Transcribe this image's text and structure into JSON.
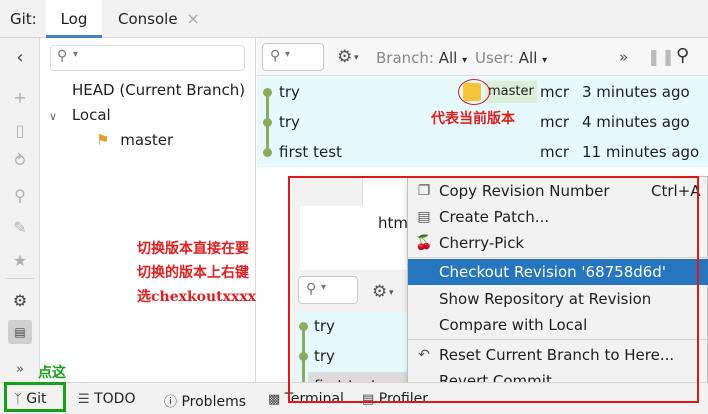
{
  "tabbar": {
    "prefix": "Git:",
    "tabs": [
      {
        "label": "Log",
        "active": true
      },
      {
        "label": "Console",
        "active": false
      }
    ],
    "close_symbol": "×"
  },
  "branches": {
    "head": "HEAD (Current Branch)",
    "local_group": "Local",
    "local_branches": [
      "master"
    ]
  },
  "log_toolbar": {
    "branch_label": "Branch:",
    "branch_value": "All",
    "user_label": "User:",
    "user_value": "All",
    "more": "»"
  },
  "commits": [
    {
      "message": "try",
      "ref": "master",
      "author": "mcr",
      "date": "3 minutes ago"
    },
    {
      "message": "try",
      "ref": "",
      "author": "mcr",
      "date": "4 minutes ago"
    },
    {
      "message": "first test",
      "ref": "",
      "author": "mcr",
      "date": "11 minutes ago"
    }
  ],
  "sub_window": {
    "tab_fragment": "htm",
    "commits": [
      "try",
      "try",
      "first test"
    ]
  },
  "context_menu": {
    "items": [
      {
        "label": "Copy Revision Number",
        "shortcut": "Ctrl+A",
        "icon": "copy-icon"
      },
      {
        "label": "Create Patch...",
        "icon": "patch-icon"
      },
      {
        "label": "Cherry-Pick",
        "icon": "cherry-icon"
      },
      {
        "label": "Checkout Revision '68758d6d'",
        "selected": true
      },
      {
        "label": "Show Repository at Revision"
      },
      {
        "label": "Compare with Local"
      },
      {
        "label": "Reset Current Branch to Here...",
        "icon": "undo-icon"
      },
      {
        "label": "Revert Commit"
      }
    ]
  },
  "bottom_bar": {
    "tabs": [
      "Git",
      "TODO",
      "Problems",
      "Terminal",
      "Profiler"
    ]
  },
  "annotations": {
    "current_version": "代表当前版本",
    "switch_line1": "切换版本直接在要",
    "switch_line2": "切换的版本上右键",
    "switch_line3": "选chexkoutxxxx",
    "click_here": "点这"
  },
  "colors": {
    "accent": "#4083c9",
    "selected_row": "#e6fafd",
    "menu_selected": "#2675bf",
    "graph": "#8aac5c",
    "annotation": "#e02020",
    "highlight_green": "#18a018"
  }
}
